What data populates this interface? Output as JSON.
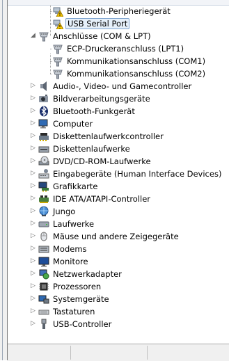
{
  "tree": {
    "items": [
      {
        "label": "Bluetooth-Peripheriegerät",
        "icon": "warning-device-icon",
        "level": 2,
        "expander": "none"
      },
      {
        "label": "USB Serial Port",
        "icon": "warning-device-icon",
        "level": 2,
        "expander": "none",
        "selected": true
      },
      {
        "label": "Anschlüsse (COM & LPT)",
        "icon": "port-icon",
        "level": 1,
        "expander": "expanded"
      },
      {
        "label": "ECP-Druckeranschluss (LPT1)",
        "icon": "port-icon",
        "level": 2,
        "expander": "none"
      },
      {
        "label": "Kommunikationsanschluss (COM1)",
        "icon": "port-icon",
        "level": 2,
        "expander": "none"
      },
      {
        "label": "Kommunikationsanschluss (COM2)",
        "icon": "port-icon",
        "level": 2,
        "expander": "none"
      },
      {
        "label": "Audio-, Video- und Gamecontroller",
        "icon": "speaker-icon",
        "level": 1,
        "expander": "collapsed"
      },
      {
        "label": "Bildverarbeitungsgeräte",
        "icon": "camera-icon",
        "level": 1,
        "expander": "collapsed"
      },
      {
        "label": "Bluetooth-Funkgerät",
        "icon": "bluetooth-icon",
        "level": 1,
        "expander": "collapsed"
      },
      {
        "label": "Computer",
        "icon": "computer-icon",
        "level": 1,
        "expander": "collapsed"
      },
      {
        "label": "Diskettenlaufwerkcontroller",
        "icon": "floppy-controller-icon",
        "level": 1,
        "expander": "collapsed"
      },
      {
        "label": "Diskettenlaufwerke",
        "icon": "floppy-drive-icon",
        "level": 1,
        "expander": "collapsed"
      },
      {
        "label": "DVD/CD-ROM-Laufwerke",
        "icon": "dvd-icon",
        "level": 1,
        "expander": "collapsed"
      },
      {
        "label": "Eingabegeräte (Human Interface Devices)",
        "icon": "hid-icon",
        "level": 1,
        "expander": "collapsed"
      },
      {
        "label": "Grafikkarte",
        "icon": "display-adapter-icon",
        "level": 1,
        "expander": "collapsed"
      },
      {
        "label": "IDE ATA/ATAPI-Controller",
        "icon": "ide-controller-icon",
        "level": 1,
        "expander": "collapsed"
      },
      {
        "label": "Jungo",
        "icon": "network-globe-icon",
        "level": 1,
        "expander": "collapsed"
      },
      {
        "label": "Laufwerke",
        "icon": "disk-drive-icon",
        "level": 1,
        "expander": "collapsed"
      },
      {
        "label": "Mäuse und andere Zeigegeräte",
        "icon": "mouse-icon",
        "level": 1,
        "expander": "collapsed"
      },
      {
        "label": "Modems",
        "icon": "modem-icon",
        "level": 1,
        "expander": "collapsed"
      },
      {
        "label": "Monitore",
        "icon": "monitor-icon",
        "level": 1,
        "expander": "collapsed"
      },
      {
        "label": "Netzwerkadapter",
        "icon": "network-adapter-icon",
        "level": 1,
        "expander": "collapsed"
      },
      {
        "label": "Prozessoren",
        "icon": "processor-icon",
        "level": 1,
        "expander": "collapsed"
      },
      {
        "label": "Systemgeräte",
        "icon": "system-devices-icon",
        "level": 1,
        "expander": "collapsed"
      },
      {
        "label": "Tastaturen",
        "icon": "keyboard-icon",
        "level": 1,
        "expander": "collapsed"
      },
      {
        "label": "USB-Controller",
        "icon": "usb-icon",
        "level": 1,
        "expander": "collapsed"
      }
    ]
  },
  "colors": {
    "selection_bg": "#e6f0fa",
    "selection_border": "#7da2ce",
    "warning_yellow": "#f5c400"
  }
}
